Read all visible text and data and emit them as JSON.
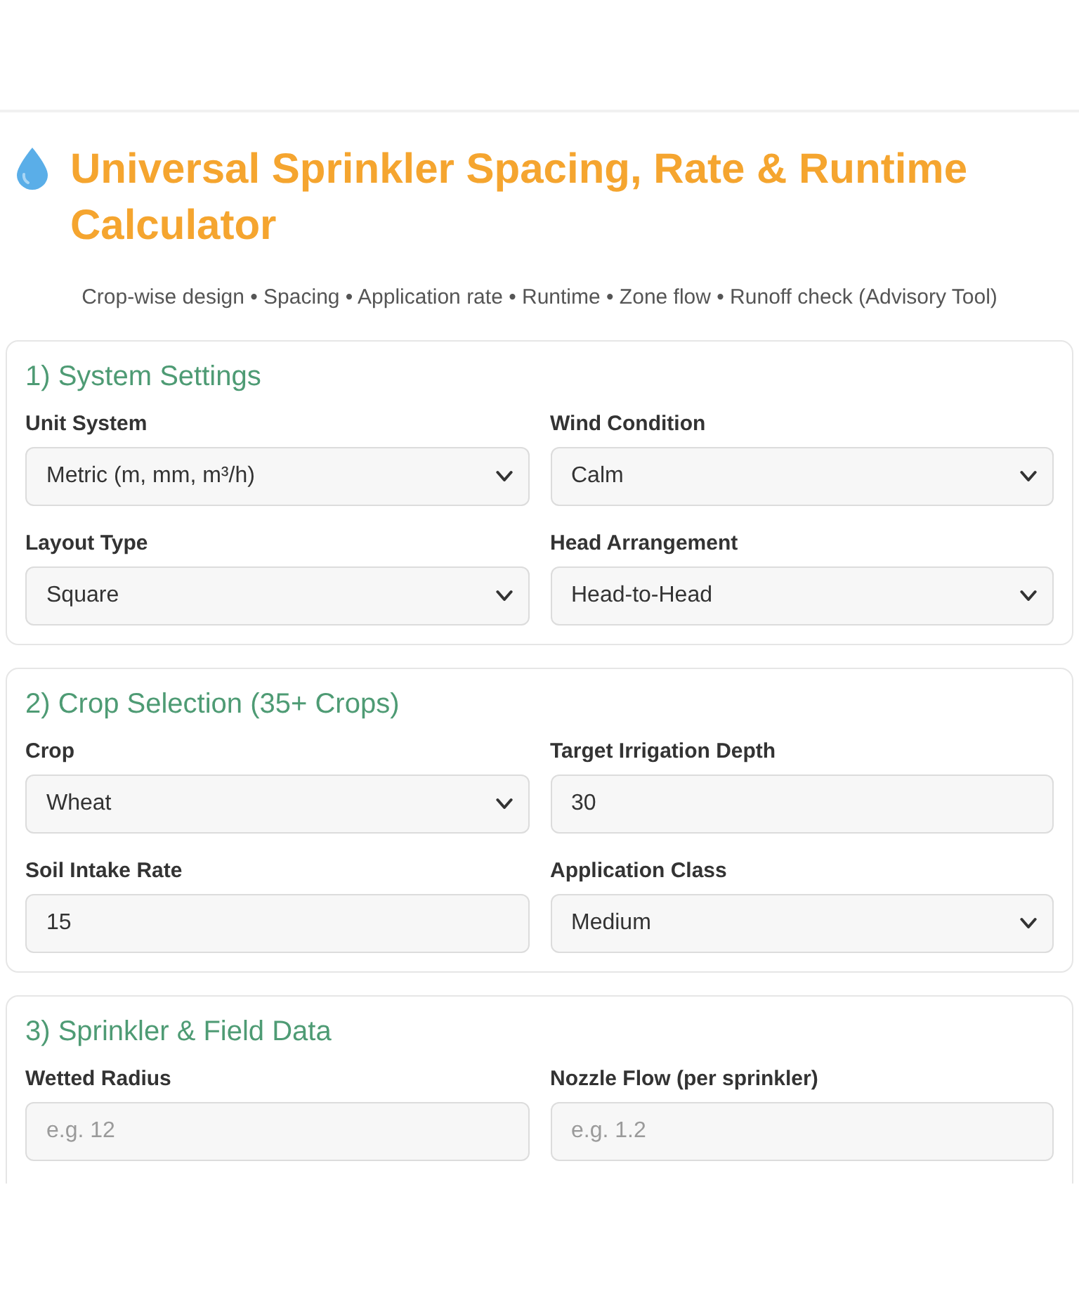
{
  "header": {
    "title": "Universal Sprinkler Spacing, Rate & Runtime Calculator",
    "subtitle": "Crop-wise design • Spacing • Application rate • Runtime • Zone flow • Runoff check (Advisory Tool)"
  },
  "sections": [
    {
      "heading": "1) System Settings",
      "fields": [
        {
          "label": "Unit System",
          "kind": "select",
          "value": "Metric (m, mm, m³/h)"
        },
        {
          "label": "Wind Condition",
          "kind": "select",
          "value": "Calm"
        },
        {
          "label": "Layout Type",
          "kind": "select",
          "value": "Square"
        },
        {
          "label": "Head Arrangement",
          "kind": "select",
          "value": "Head-to-Head"
        }
      ]
    },
    {
      "heading": "2) Crop Selection (35+ Crops)",
      "fields": [
        {
          "label": "Crop",
          "kind": "select",
          "value": "Wheat"
        },
        {
          "label": "Target Irrigation Depth",
          "kind": "input",
          "value": "30"
        },
        {
          "label": "Soil Intake Rate",
          "kind": "input",
          "value": "15"
        },
        {
          "label": "Application Class",
          "kind": "select",
          "value": "Medium"
        }
      ]
    },
    {
      "heading": "3) Sprinkler & Field Data",
      "fields": [
        {
          "label": "Wetted Radius",
          "kind": "input",
          "placeholder": "e.g. 12"
        },
        {
          "label": "Nozzle Flow (per sprinkler)",
          "kind": "input",
          "placeholder": "e.g. 1.2"
        }
      ]
    }
  ]
}
